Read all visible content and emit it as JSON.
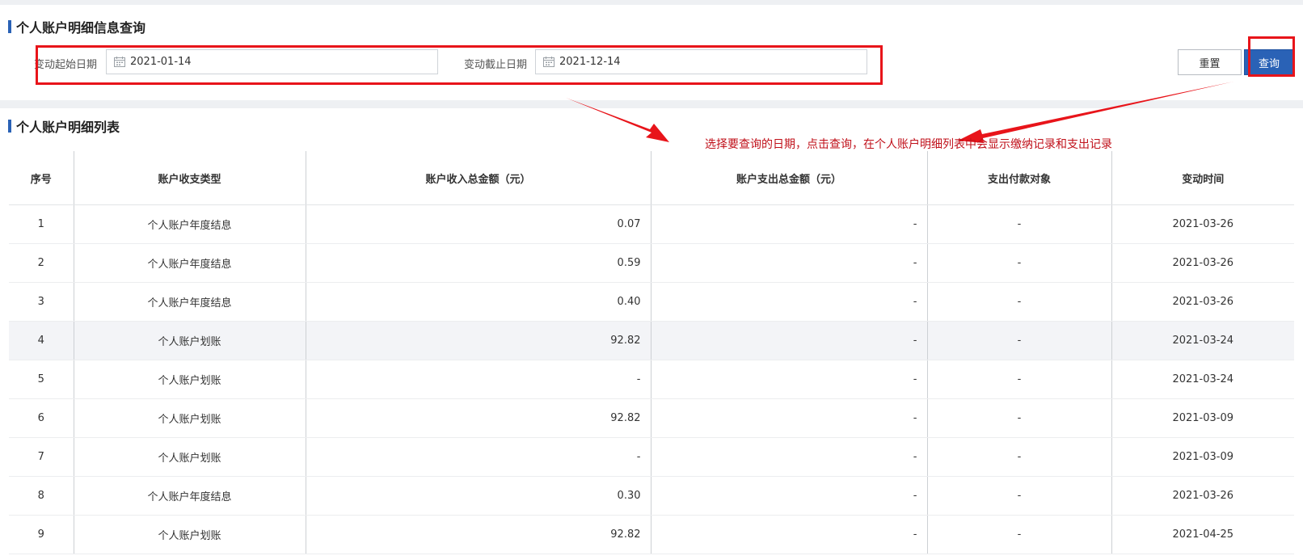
{
  "query_panel": {
    "title": "个人账户明细信息查询",
    "start_label": "变动起始日期",
    "start_value": "2021-01-14",
    "end_label": "变动截止日期",
    "end_value": "2021-12-14",
    "reset_label": "重置",
    "query_label": "查询"
  },
  "list_panel": {
    "title": "个人账户明细列表",
    "columns": [
      "序号",
      "账户收支类型",
      "账户收入总金额（元）",
      "账户支出总金额（元）",
      "支出付款对象",
      "变动时间"
    ],
    "rows": [
      [
        "1",
        "个人账户年度结息",
        "0.07",
        "-",
        "-",
        "2021-03-26"
      ],
      [
        "2",
        "个人账户年度结息",
        "0.59",
        "-",
        "-",
        "2021-03-26"
      ],
      [
        "3",
        "个人账户年度结息",
        "0.40",
        "-",
        "-",
        "2021-03-26"
      ],
      [
        "4",
        "个人账户划账",
        "92.82",
        "-",
        "-",
        "2021-03-24"
      ],
      [
        "5",
        "个人账户划账",
        "-",
        "-",
        "-",
        "2021-03-24"
      ],
      [
        "6",
        "个人账户划账",
        "92.82",
        "-",
        "-",
        "2021-03-09"
      ],
      [
        "7",
        "个人账户划账",
        "-",
        "-",
        "-",
        "2021-03-09"
      ],
      [
        "8",
        "个人账户年度结息",
        "0.30",
        "-",
        "-",
        "2021-03-26"
      ],
      [
        "9",
        "个人账户划账",
        "92.82",
        "-",
        "-",
        "2021-04-25"
      ]
    ]
  },
  "annotation": {
    "text": "选择要查询的日期，点击查询，在个人账户明细列表中会显示缴纳记录和支出记录",
    "color": "#e8141a"
  },
  "colors": {
    "accent": "#2a62b6",
    "highlight_row": "#f3f4f7"
  },
  "icons": {
    "date_icon": "calendar-icon",
    "arrow": "arrow-icon"
  }
}
